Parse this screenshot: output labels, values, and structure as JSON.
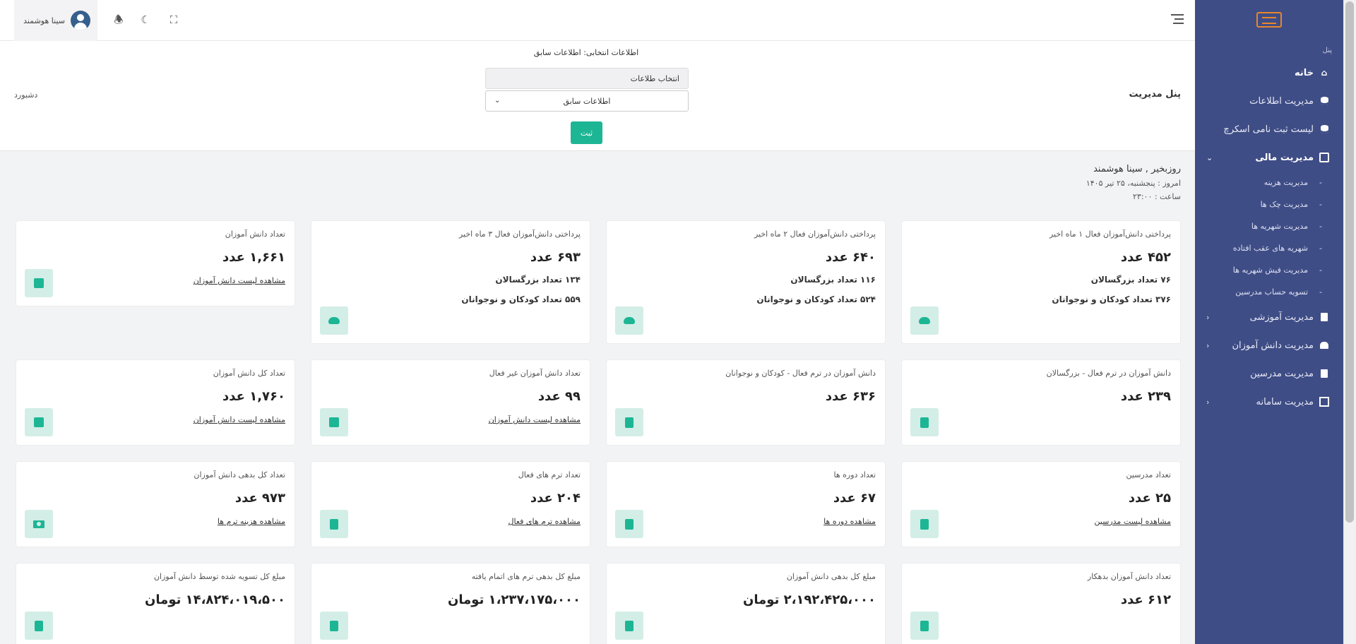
{
  "sidebar": {
    "section_label": "پنل",
    "items": [
      {
        "label": "خانه",
        "icon": "home-icon",
        "active": true
      },
      {
        "label": "مدیریت اطلاعات",
        "icon": "database-icon"
      },
      {
        "label": "لیست ثبت نامی اسکرچ",
        "icon": "database-icon"
      },
      {
        "label": "مدیریت مالی",
        "icon": "wallet-icon",
        "expanded": true
      },
      {
        "label": "مدیریت آموزشی",
        "icon": "board-icon"
      },
      {
        "label": "مدیریت دانش آموزان",
        "icon": "team-icon"
      },
      {
        "label": "مدیریت مدرسین",
        "icon": "board-icon"
      },
      {
        "label": "مدیریت سامانه",
        "icon": "monitor-icon"
      }
    ],
    "finance_sub": [
      "مدیریت هزینه",
      "مدیریت چک ها",
      "مدیریت شهریه ها",
      "شهریه های عقب افتاده",
      "مدیریت فیش شهریه ها",
      "تسویه حساب مدرسین"
    ]
  },
  "header": {
    "user_name": "سینا هوشمند"
  },
  "filter": {
    "selected_info": "اطلاعات انتخابی: اطلاعات سابق",
    "select_label": "انتخاب طلاعات",
    "select_value": "اطلاعات سابق",
    "submit_label": "ثبت",
    "panel_title": "پنل مدیریت",
    "dashboard_link": "دشبورد"
  },
  "greeting": {
    "hello": "روزبخیر , سینا هوشمند",
    "date": "امروز : پنجشنبه، ۲۵ تیر ۱۴۰۵",
    "time": "ساعت : ۲۳:۰۰"
  },
  "cards": [
    [
      {
        "title": "پرداختی دانش‌آموزان فعال ۱ ماه اخیر",
        "value": "۴۵۲ عدد",
        "extra1": "۷۶ تعداد بزرگسالان",
        "extra2": "۳۷۶ تعداد کودکان و نوجوانان",
        "icon": "cloud-upload-icon"
      },
      {
        "title": "پرداختی دانش‌آموزان فعال ۲ ماه اخیر",
        "value": "۶۴۰ عدد",
        "extra1": "۱۱۶ تعداد بزرگسالان",
        "extra2": "۵۲۴ تعداد کودکان و نوجوانان",
        "icon": "cloud-upload-icon"
      },
      {
        "title": "پرداختی دانش‌آموزان فعال ۳ ماه اخیر",
        "value": "۶۹۳ عدد",
        "extra1": "۱۳۴ تعداد بزرگسالان",
        "extra2": "۵۵۹ تعداد کودکان و نوجوانان",
        "icon": "cloud-upload-icon"
      },
      {
        "title": "تعداد دانش آموزان",
        "value": "۱,۶۶۱ عدد",
        "link": "مشاهده لیست دانش آموزان",
        "icon": "school-icon"
      }
    ],
    [
      {
        "title": "دانش آموزان در ترم فعال - بزرگسالان",
        "value": "۲۳۹ عدد",
        "icon": "book-open-icon"
      },
      {
        "title": "دانش آموزان در ترم فعال - کودکان و نوجوانان",
        "value": "۶۳۶ عدد",
        "icon": "book-open-icon"
      },
      {
        "title": "تعداد دانش آموزان غیر فعال",
        "value": "۹۹ عدد",
        "link": "مشاهده لیست دانش آموزان",
        "icon": "school-icon"
      },
      {
        "title": "تعداد کل دانش آموزان",
        "value": "۱,۷۶۰ عدد",
        "link": "مشاهده لیست دانش آموزان",
        "icon": "school-icon"
      }
    ],
    [
      {
        "title": "تعداد مدرسین",
        "value": "۲۵ عدد",
        "link": "مشاهده لیست مدرسین",
        "icon": "id-card-icon"
      },
      {
        "title": "تعداد دوره ها",
        "value": "۶۷ عدد",
        "link": "مشاهده دوره ها",
        "icon": "book-open-icon"
      },
      {
        "title": "تعداد ترم های فعال",
        "value": "۲۰۴ عدد",
        "link": "مشاهده ترم های فعال",
        "icon": "book-icon"
      },
      {
        "title": "تعداد کل بدهی دانش آموزان",
        "value": "۹۷۳ عدد",
        "link": "مشاهده هزینه ترم ها",
        "icon": "money-icon"
      }
    ],
    [
      {
        "title": "تعداد دانش آموزان بدهکار",
        "value": "۶۱۲ عدد",
        "icon": "id-card-icon"
      },
      {
        "title": "مبلغ کل بدهی دانش آموزان",
        "value": "۲،۱۹۲،۴۲۵،۰۰۰ تومان",
        "icon": "invoice-icon"
      },
      {
        "title": "مبلغ کل بدهی ترم های اتمام یافته",
        "value": "۱،۲۳۷،۱۷۵،۰۰۰ تومان",
        "icon": "invoice-icon"
      },
      {
        "title": "مبلغ کل تسویه شده توسط دانش آموزان",
        "value": "۱۴،۸۲۴،۰۱۹،۵۰۰ تومان",
        "icon": "invoice-icon"
      }
    ]
  ]
}
